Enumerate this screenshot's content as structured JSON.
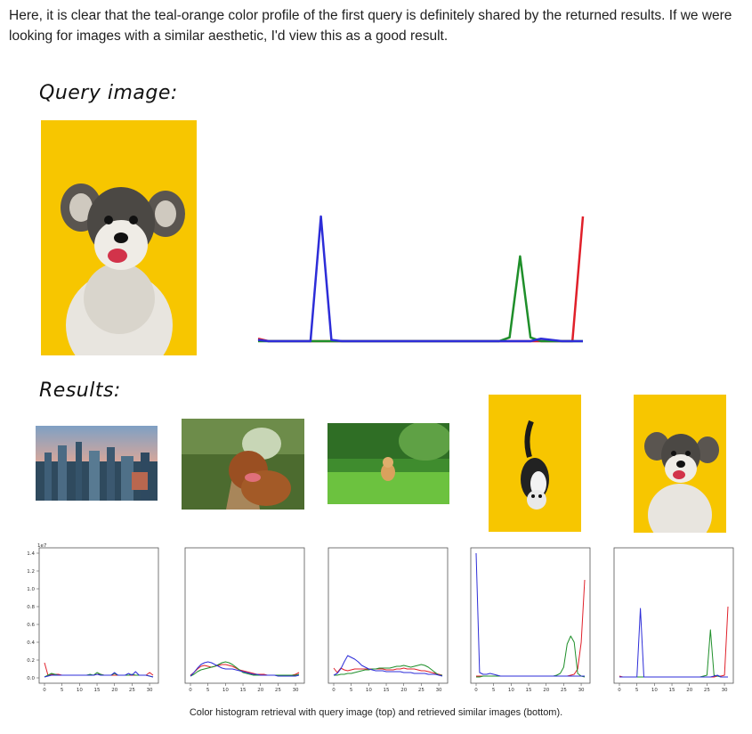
{
  "intro_text": "Here, it is clear that the teal-orange color profile of the first query is definitely shared by the returned results. If we were looking for images with a similar aesthetic, I'd view this as a good result.",
  "query_heading": "Query image:",
  "results_heading": "Results:",
  "caption": "Color histogram retrieval with query image (top) and retrieved similar images (bottom).",
  "colors": {
    "red": "#e0202a",
    "green": "#1f8f2a",
    "blue": "#2d2dd8",
    "yellow_bg": "#f7c600"
  },
  "images": {
    "query": "schnauzer-on-yellow",
    "results": [
      "city-skyline",
      "dog-on-forest-path",
      "kitten-in-grass",
      "cat-on-yellow",
      "schnauzer-on-yellow"
    ]
  },
  "chart_data": [
    {
      "type": "line",
      "x": [
        0,
        1,
        2,
        3,
        4,
        5,
        6,
        7,
        8,
        9,
        10,
        11,
        12,
        13,
        14,
        15,
        16,
        17,
        18,
        19,
        20,
        21,
        22,
        23,
        24,
        25,
        26,
        27,
        28,
        29,
        30,
        31
      ],
      "series": [
        {
          "color": "red",
          "values": [
            0.02,
            0,
            0,
            0,
            0,
            0,
            0,
            0,
            0,
            0,
            0,
            0,
            0,
            0,
            0,
            0,
            0,
            0,
            0,
            0,
            0,
            0,
            0,
            0,
            0,
            0,
            0,
            0,
            0,
            0,
            0,
            1.0
          ]
        },
        {
          "color": "green",
          "values": [
            0,
            0,
            0,
            0,
            0,
            0,
            0,
            0,
            0,
            0,
            0,
            0,
            0,
            0,
            0,
            0,
            0,
            0,
            0,
            0,
            0,
            0,
            0,
            0,
            0.03,
            0.68,
            0.03,
            0,
            0,
            0,
            0,
            0
          ]
        },
        {
          "color": "blue",
          "values": [
            0.01,
            0,
            0,
            0,
            0,
            0,
            1.0,
            0.01,
            0,
            0,
            0,
            0,
            0,
            0,
            0,
            0,
            0,
            0,
            0,
            0,
            0,
            0,
            0,
            0,
            0,
            0,
            0,
            0.02,
            0.01,
            0,
            0,
            0
          ]
        }
      ]
    },
    {
      "type": "line",
      "yticks": [
        "0.0",
        "0.2",
        "0.4",
        "0.6",
        "0.8",
        "1.0",
        "1.2",
        "1.4"
      ],
      "y_exponent": "1e7",
      "xticks": [
        "0",
        "5",
        "10",
        "15",
        "20",
        "25",
        "30"
      ],
      "ylim": [
        0,
        1.4
      ],
      "x": [
        0,
        1,
        2,
        3,
        4,
        5,
        6,
        7,
        8,
        9,
        10,
        11,
        12,
        13,
        14,
        15,
        16,
        17,
        18,
        19,
        20,
        21,
        22,
        23,
        24,
        25,
        26,
        27,
        28,
        29,
        30,
        31
      ],
      "series": [
        {
          "color": "red",
          "values": [
            0.17,
            0.03,
            0.04,
            0.04,
            0.04,
            0.03,
            0.03,
            0.03,
            0.03,
            0.03,
            0.03,
            0.03,
            0.03,
            0.03,
            0.03,
            0.04,
            0.04,
            0.03,
            0.03,
            0.03,
            0.03,
            0.03,
            0.03,
            0.03,
            0.03,
            0.03,
            0.03,
            0.03,
            0.03,
            0.03,
            0.06,
            0.03
          ]
        },
        {
          "color": "green",
          "values": [
            0.01,
            0.03,
            0.05,
            0.04,
            0.03,
            0.03,
            0.03,
            0.03,
            0.03,
            0.03,
            0.03,
            0.03,
            0.03,
            0.04,
            0.03,
            0.06,
            0.04,
            0.03,
            0.03,
            0.03,
            0.05,
            0.03,
            0.03,
            0.03,
            0.03,
            0.04,
            0.03,
            0.03,
            0.03,
            0.03,
            0.02,
            0.01
          ]
        },
        {
          "color": "blue",
          "values": [
            0.01,
            0.02,
            0.03,
            0.03,
            0.03,
            0.03,
            0.03,
            0.03,
            0.03,
            0.03,
            0.03,
            0.03,
            0.03,
            0.03,
            0.03,
            0.04,
            0.03,
            0.03,
            0.03,
            0.03,
            0.06,
            0.03,
            0.03,
            0.03,
            0.05,
            0.03,
            0.07,
            0.03,
            0.03,
            0.03,
            0.02,
            0.01
          ]
        }
      ]
    },
    {
      "type": "line",
      "xticks": [
        "0",
        "5",
        "10",
        "15",
        "20",
        "25",
        "30"
      ],
      "ylim": [
        0,
        1.4
      ],
      "x": [
        0,
        1,
        2,
        3,
        4,
        5,
        6,
        7,
        8,
        9,
        10,
        11,
        12,
        13,
        14,
        15,
        16,
        17,
        18,
        19,
        20,
        21,
        22,
        23,
        24,
        25,
        26,
        27,
        28,
        29,
        30,
        31
      ],
      "series": [
        {
          "color": "red",
          "values": [
            0.03,
            0.06,
            0.1,
            0.13,
            0.14,
            0.13,
            0.12,
            0.13,
            0.14,
            0.15,
            0.15,
            0.14,
            0.13,
            0.11,
            0.09,
            0.08,
            0.07,
            0.06,
            0.05,
            0.04,
            0.04,
            0.04,
            0.03,
            0.03,
            0.03,
            0.03,
            0.03,
            0.03,
            0.03,
            0.03,
            0.04,
            0.06
          ]
        },
        {
          "color": "green",
          "values": [
            0.02,
            0.04,
            0.07,
            0.09,
            0.1,
            0.11,
            0.12,
            0.13,
            0.15,
            0.17,
            0.18,
            0.17,
            0.15,
            0.12,
            0.09,
            0.06,
            0.05,
            0.04,
            0.03,
            0.03,
            0.03,
            0.03,
            0.03,
            0.03,
            0.03,
            0.03,
            0.03,
            0.03,
            0.03,
            0.03,
            0.03,
            0.04
          ]
        },
        {
          "color": "blue",
          "values": [
            0.02,
            0.06,
            0.11,
            0.15,
            0.17,
            0.18,
            0.17,
            0.15,
            0.13,
            0.11,
            0.1,
            0.1,
            0.1,
            0.09,
            0.08,
            0.07,
            0.06,
            0.05,
            0.04,
            0.04,
            0.03,
            0.03,
            0.03,
            0.03,
            0.03,
            0.02,
            0.02,
            0.02,
            0.02,
            0.02,
            0.02,
            0.03
          ]
        }
      ]
    },
    {
      "type": "line",
      "xticks": [
        "0",
        "5",
        "10",
        "15",
        "20",
        "25",
        "30"
      ],
      "ylim": [
        0,
        1.4
      ],
      "x": [
        0,
        1,
        2,
        3,
        4,
        5,
        6,
        7,
        8,
        9,
        10,
        11,
        12,
        13,
        14,
        15,
        16,
        17,
        18,
        19,
        20,
        21,
        22,
        23,
        24,
        25,
        26,
        27,
        28,
        29,
        30,
        31
      ],
      "series": [
        {
          "color": "red",
          "values": [
            0.11,
            0.06,
            0.11,
            0.09,
            0.08,
            0.09,
            0.1,
            0.1,
            0.1,
            0.1,
            0.1,
            0.1,
            0.1,
            0.1,
            0.1,
            0.09,
            0.09,
            0.09,
            0.1,
            0.1,
            0.11,
            0.1,
            0.1,
            0.1,
            0.09,
            0.08,
            0.08,
            0.07,
            0.06,
            0.05,
            0.04,
            0.03
          ]
        },
        {
          "color": "green",
          "values": [
            0.03,
            0.03,
            0.04,
            0.04,
            0.05,
            0.05,
            0.06,
            0.07,
            0.08,
            0.09,
            0.09,
            0.1,
            0.1,
            0.11,
            0.11,
            0.11,
            0.11,
            0.12,
            0.13,
            0.13,
            0.14,
            0.13,
            0.12,
            0.13,
            0.14,
            0.15,
            0.14,
            0.12,
            0.09,
            0.06,
            0.03,
            0.03
          ]
        },
        {
          "color": "blue",
          "values": [
            0.03,
            0.05,
            0.1,
            0.18,
            0.25,
            0.23,
            0.21,
            0.18,
            0.14,
            0.12,
            0.1,
            0.09,
            0.08,
            0.08,
            0.08,
            0.07,
            0.07,
            0.07,
            0.07,
            0.07,
            0.06,
            0.06,
            0.06,
            0.05,
            0.05,
            0.05,
            0.05,
            0.04,
            0.04,
            0.04,
            0.03,
            0.02
          ]
        }
      ]
    },
    {
      "type": "line",
      "xticks": [
        "0",
        "5",
        "10",
        "15",
        "20",
        "25",
        "30"
      ],
      "ylim": [
        0,
        1.4
      ],
      "x": [
        0,
        1,
        2,
        3,
        4,
        5,
        6,
        7,
        8,
        9,
        10,
        11,
        12,
        13,
        14,
        15,
        16,
        17,
        18,
        19,
        20,
        21,
        22,
        23,
        24,
        25,
        26,
        27,
        28,
        29,
        30,
        31
      ],
      "series": [
        {
          "color": "red",
          "values": [
            0.02,
            0.02,
            0.02,
            0.02,
            0.02,
            0.02,
            0.02,
            0.02,
            0.02,
            0.02,
            0.02,
            0.02,
            0.02,
            0.02,
            0.02,
            0.02,
            0.02,
            0.02,
            0.02,
            0.02,
            0.02,
            0.02,
            0.02,
            0.02,
            0.02,
            0.02,
            0.02,
            0.03,
            0.04,
            0.1,
            0.4,
            1.1
          ]
        },
        {
          "color": "green",
          "values": [
            0.01,
            0.01,
            0.02,
            0.02,
            0.02,
            0.02,
            0.02,
            0.02,
            0.02,
            0.02,
            0.02,
            0.02,
            0.02,
            0.02,
            0.02,
            0.02,
            0.02,
            0.02,
            0.02,
            0.02,
            0.02,
            0.02,
            0.02,
            0.03,
            0.05,
            0.12,
            0.38,
            0.47,
            0.4,
            0.05,
            0.02,
            0.01
          ]
        },
        {
          "color": "blue",
          "values": [
            1.4,
            0.06,
            0.04,
            0.04,
            0.05,
            0.04,
            0.03,
            0.02,
            0.02,
            0.02,
            0.02,
            0.02,
            0.02,
            0.02,
            0.02,
            0.02,
            0.02,
            0.02,
            0.02,
            0.02,
            0.02,
            0.02,
            0.02,
            0.02,
            0.02,
            0.02,
            0.02,
            0.02,
            0.02,
            0.02,
            0.02,
            0.02
          ]
        }
      ]
    },
    {
      "type": "line",
      "xticks": [
        "0",
        "5",
        "10",
        "15",
        "20",
        "25",
        "30"
      ],
      "ylim": [
        0,
        1.4
      ],
      "x": [
        0,
        1,
        2,
        3,
        4,
        5,
        6,
        7,
        8,
        9,
        10,
        11,
        12,
        13,
        14,
        15,
        16,
        17,
        18,
        19,
        20,
        21,
        22,
        23,
        24,
        25,
        26,
        27,
        28,
        29,
        30,
        31
      ],
      "series": [
        {
          "color": "red",
          "values": [
            0.02,
            0.01,
            0.01,
            0.01,
            0.01,
            0.01,
            0.01,
            0.01,
            0.01,
            0.01,
            0.01,
            0.01,
            0.01,
            0.01,
            0.01,
            0.01,
            0.01,
            0.01,
            0.01,
            0.01,
            0.01,
            0.01,
            0.01,
            0.01,
            0.01,
            0.01,
            0.01,
            0.01,
            0.02,
            0.02,
            0.03,
            0.8
          ]
        },
        {
          "color": "green",
          "values": [
            0.01,
            0.01,
            0.01,
            0.01,
            0.01,
            0.01,
            0.01,
            0.01,
            0.01,
            0.01,
            0.01,
            0.01,
            0.01,
            0.01,
            0.01,
            0.01,
            0.01,
            0.01,
            0.01,
            0.01,
            0.01,
            0.01,
            0.01,
            0.01,
            0.02,
            0.03,
            0.54,
            0.03,
            0.02,
            0.01,
            0.01,
            0.01
          ]
        },
        {
          "color": "blue",
          "values": [
            0.01,
            0.01,
            0.01,
            0.01,
            0.01,
            0.01,
            0.78,
            0.01,
            0.01,
            0.01,
            0.01,
            0.01,
            0.01,
            0.01,
            0.01,
            0.01,
            0.01,
            0.01,
            0.01,
            0.01,
            0.01,
            0.01,
            0.01,
            0.01,
            0.01,
            0.01,
            0.01,
            0.02,
            0.03,
            0.01,
            0.01,
            0.01
          ]
        }
      ]
    }
  ]
}
